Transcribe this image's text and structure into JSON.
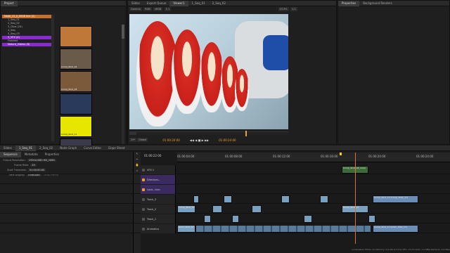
{
  "colors": {
    "accent": "#f0a020",
    "playhead": "#e07020",
    "bg": "#1c1c1c"
  },
  "left_panel": {
    "tabs": [
      "Project",
      "",
      ""
    ],
    "tree": [
      {
        "label": "Node_12_II_0008 Ime (2)",
        "style": "orange"
      },
      {
        "label": "1_Seq_01",
        "style": "plain"
      },
      {
        "label": "2_Seq_02",
        "style": "plain"
      },
      {
        "label": "3_Clips (24)",
        "style": "plain"
      },
      {
        "label": "4_Seq",
        "style": "plain"
      },
      {
        "label": "5_Seq_03",
        "style": "plain"
      },
      {
        "label": "5_VFX (4)",
        "style": "purple"
      },
      {
        "label": "Finished",
        "style": "plain"
      },
      {
        "label": "Nature_Videos (6)",
        "style": "purple"
      }
    ],
    "thumbs": [
      {
        "label": "",
        "color": "#c07838"
      },
      {
        "label": "Comp_Shot_01",
        "color": "#6a5a4a"
      },
      {
        "label": "Comp_Shot_03",
        "color": "#7a5a3a"
      },
      {
        "label": "",
        "color": "#2a3a5a"
      },
      {
        "label": "Comp_Shot_11",
        "color": "#e6e600"
      },
      {
        "label": "",
        "color": "#3a3a4a"
      }
    ]
  },
  "viewer": {
    "tabs": [
      "Slides",
      "Export Queue",
      "Viewer1",
      "1_Seq_01",
      "2_Seq_02"
    ],
    "toolbar": [
      "Gamma",
      "RGB",
      "sRGB",
      "1:1",
      "43.9%",
      "1:1"
    ],
    "transport": [
      "25*",
      "Global"
    ],
    "timecode_left": "01:00:20:00",
    "timecode_right": "01:00:24:00"
  },
  "properties": {
    "tabs": [
      "Properties",
      "Background Renders"
    ]
  },
  "bottom": {
    "tabs": [
      "Slides",
      "1_Seq_01",
      "2_Seq_02",
      "Node Graph",
      "Curve Editor",
      "Dope Sheet"
    ],
    "subtabs": [
      "Sequence",
      "Metadata",
      "Properties"
    ],
    "settings": [
      {
        "label": "Output Resolution:",
        "value": "1920x1080 HD_1080"
      },
      {
        "label": "Frame Rate:",
        "value": "25"
      },
      {
        "label": "Start Timecode:",
        "value": "01:00:00:00"
      },
      {
        "label": "Time Display:",
        "value": "Timecode"
      }
    ],
    "drop_frame": "Drop Frame",
    "timecode": "01:00:22:00",
    "ruler": [
      "01:00:04:00",
      "01:00:08:00",
      "01:00:12:00",
      "01:00:16:00",
      "01:00:20:00",
      "01:00:24:00"
    ],
    "tracks": [
      {
        "name": "VFX 1"
      },
      {
        "name": "Directors..."
      },
      {
        "name": "Loca...Icon"
      },
      {
        "name": "Track_3"
      },
      {
        "name": "Track_2"
      },
      {
        "name": "Track_1"
      },
      {
        "name": "Animatics"
      }
    ],
    "clips": [
      {
        "label": "Comp_Shot_18_comp",
        "color": "#3e6a3a"
      },
      {
        "label": "Comp_Shot_17",
        "color": "#7aa0bf"
      },
      {
        "label": "Comp_Shot_17 (Comp_Shot_17)",
        "color": "#6a8db5"
      },
      {
        "label": "Comp_Shot_14",
        "color": "#7aa0bf"
      },
      {
        "label": "Comp_Shot_17 (Anim_Shot_17)",
        "color": "#6a8db5"
      },
      {
        "label": "Anim_Shot_12",
        "color": "#7aa0bf"
      }
    ]
  },
  "status_bar": "Localisation Mode: On  Memory: 2.6 GB (17.0%)  CPU: 13.2%  Disk: 1.2 MB/s  Network: 0.0 KB/s"
}
